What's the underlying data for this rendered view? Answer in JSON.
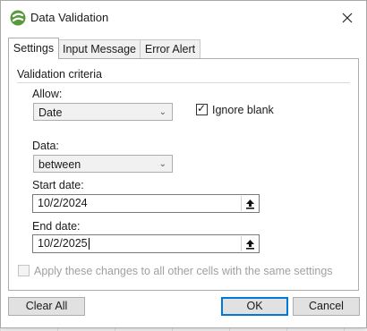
{
  "dialog": {
    "title": "Data Validation",
    "close_symbol": "✕"
  },
  "tabs": [
    {
      "label": "Settings",
      "active": true
    },
    {
      "label": "Input Message",
      "active": false
    },
    {
      "label": "Error Alert",
      "active": false
    }
  ],
  "settings": {
    "section_label": "Validation criteria",
    "allow_label": "Allow:",
    "allow_value": "Date",
    "ignore_blank_label": "Ignore blank",
    "ignore_blank_checked": true,
    "data_label": "Data:",
    "data_value": "between",
    "start_date_label": "Start date:",
    "start_date_value": "10/2/2024",
    "end_date_label": "End date:",
    "end_date_value": "10/2/2025",
    "apply_all_label": "Apply these changes to all other cells with the same settings",
    "apply_all_checked": false
  },
  "buttons": {
    "clear_all": "Clear All",
    "ok": "OK",
    "cancel": "Cancel"
  },
  "icons": {
    "app_logo": "spreadsheet-logo-icon",
    "close": "close-icon",
    "dropdown": "chevron-down-icon",
    "range_select": "range-select-icon",
    "checkmark": "checkmark-icon"
  },
  "colors": {
    "accent": "#0078d7",
    "logo": "#5a9a3c"
  }
}
